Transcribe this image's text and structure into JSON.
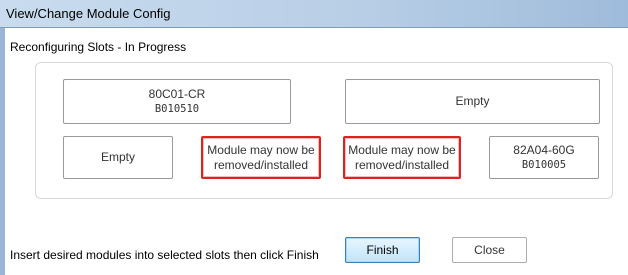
{
  "window": {
    "title": "View/Change Module Config"
  },
  "status_text": "Reconfiguring Slots - In Progress",
  "slots": [
    {
      "line1": "80C01-CR",
      "line2": "B010510",
      "highlighted": false
    },
    {
      "line1": "Empty",
      "line2": "",
      "highlighted": false
    },
    {
      "line1": "Empty",
      "line2": "",
      "highlighted": false
    },
    {
      "line1": "Module may now be",
      "line2": "removed/installed",
      "highlighted": true
    },
    {
      "line1": "Module may now be",
      "line2": "removed/installed",
      "highlighted": true
    },
    {
      "line1": "82A04-60G",
      "line2": "B010005",
      "highlighted": false
    }
  ],
  "instructions": "Insert desired modules into selected slots then click Finish",
  "buttons": {
    "finish": "Finish",
    "close": "Close"
  },
  "colors": {
    "highlight_border": "#dd2222",
    "finish_button_bg": "#bfe4f9"
  }
}
